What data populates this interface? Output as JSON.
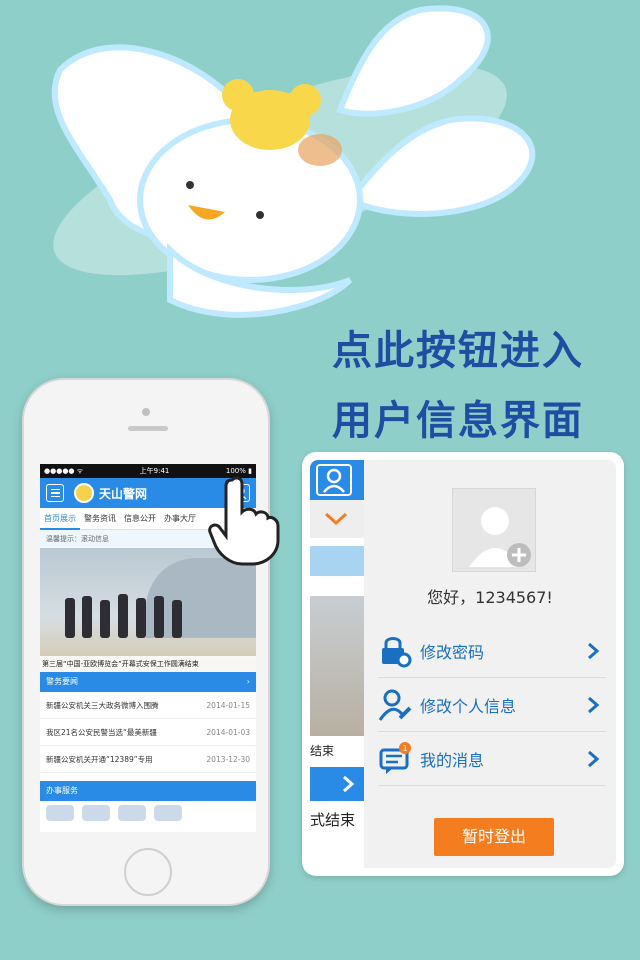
{
  "promo": {
    "line1": "点此按钮进入",
    "line2": "用户信息界面"
  },
  "phone": {
    "status": {
      "carrier": "●●●●● ᯤ",
      "time": "上午9:41",
      "battery": "100% ▮"
    },
    "app_title": "天山警网",
    "tabs": [
      "首页展示",
      "警务资讯",
      "信息公开",
      "办事大厅"
    ],
    "notice": "温馨提示：滚动信息",
    "hero_caption": "第三届“中国-亚欧博览会”开幕式安保工作圆满结束",
    "news_section": "警务要闻",
    "news": [
      {
        "title": "新疆公安机关三大政务微博入围腾",
        "date": "2014-01-15"
      },
      {
        "title": "我区21名公安民警当选“最美新疆",
        "date": "2014-01-03"
      },
      {
        "title": "新疆公安机关开通“12389”专用",
        "date": "2013-12-30"
      }
    ],
    "service_section": "办事服务"
  },
  "panel": {
    "strip_text": "结束",
    "strip_bottom_text": "式结束",
    "greeting": "您好，1234567!",
    "menu": [
      {
        "label": "修改密码",
        "icon": "lock-gear-icon"
      },
      {
        "label": "修改个人信息",
        "icon": "user-wrench-icon"
      },
      {
        "label": "我的消息",
        "icon": "chat-bubble-icon",
        "badge": "1"
      }
    ],
    "logout_label": "暂时登出"
  },
  "colors": {
    "background": "#8fcfc9",
    "accent": "#2a8be6",
    "promo": "#1e4ea1",
    "logout": "#f47d20"
  }
}
